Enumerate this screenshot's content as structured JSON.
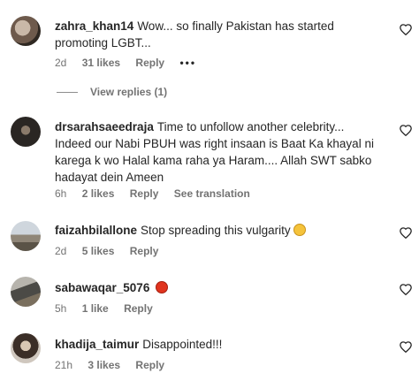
{
  "comments": [
    {
      "username": "zahra_khan14",
      "text": "Wow... so finally Pakistan has started promoting LGBT...",
      "time": "2d",
      "likes": "31 likes",
      "reply": "Reply",
      "more": "•••",
      "view_replies": "View replies (1)"
    },
    {
      "username": "drsarahsaeedraja",
      "text": "Time to unfollow another celebrity... Indeed our Nabi PBUH was right insaan is Baat Ka khayal ni karega k wo Halal kama raha ya Haram.... Allah SWT sabko hadayat dein Ameen",
      "time": "6h",
      "likes": "2 likes",
      "reply": "Reply",
      "translation": "See translation"
    },
    {
      "username": "faizahbilallone",
      "text": "Stop spreading this vulgarity",
      "emoji": "scream",
      "time": "2d",
      "likes": "5 likes",
      "reply": "Reply"
    },
    {
      "username": "sabawaqar_5076",
      "text": "",
      "emoji": "angry",
      "time": "5h",
      "likes": "1 like",
      "reply": "Reply"
    },
    {
      "username": "khadija_taimur",
      "text": "Disappointed!!!",
      "time": "21h",
      "likes": "3 likes",
      "reply": "Reply"
    }
  ]
}
